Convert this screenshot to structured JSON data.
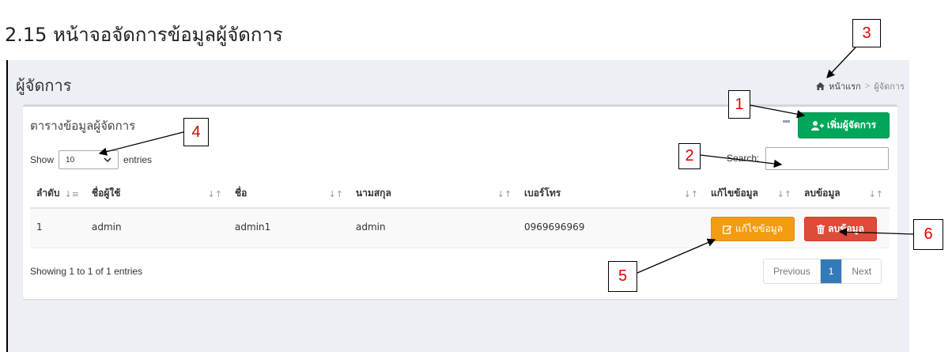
{
  "doc": {
    "heading": "2.15 หน้าจอจัดการข้อมูลผู้จัดการ"
  },
  "page": {
    "title": "ผู้จัดการ"
  },
  "breadcrumb": {
    "home": "หน้าแรก",
    "separator": ">",
    "current": "ผู้จัดการ"
  },
  "box": {
    "title": "ตารางข้อมูลผู้จัดการ",
    "add_button": "เพิ่มผู้จัดการ"
  },
  "length": {
    "show": "Show",
    "value": "10",
    "entries": "entries"
  },
  "search": {
    "label": "Search:",
    "value": ""
  },
  "table": {
    "headers": [
      "ลำดับ",
      "ชื่อผู้ใช้",
      "ชื่อ",
      "นามสกุล",
      "เบอร์โทร",
      "แก้ไขข้อมูล",
      "ลบข้อมูล"
    ],
    "rows": [
      {
        "no": "1",
        "username": "admin",
        "firstname": "admin1",
        "lastname": "admin",
        "phone": "0969696969",
        "edit": "แก้ไขข้อมูล",
        "delete": "ลบข้อมูล"
      }
    ]
  },
  "info": "Showing 1 to 1 of 1 entries",
  "pagination": {
    "previous": "Previous",
    "current": "1",
    "next": "Next"
  },
  "callouts": [
    "1",
    "2",
    "3",
    "4",
    "5",
    "6"
  ],
  "colors": {
    "add": "#00a65a",
    "edit": "#f39c12",
    "delete": "#dd4b39",
    "page_active": "#337ab7",
    "callout_text": "#e00000"
  },
  "icons": {
    "home": "home-icon",
    "add": "user-plus-icon",
    "edit": "edit-icon",
    "delete": "trash-icon",
    "collapse": "minus-icon",
    "select": "chevron-down-icon"
  }
}
